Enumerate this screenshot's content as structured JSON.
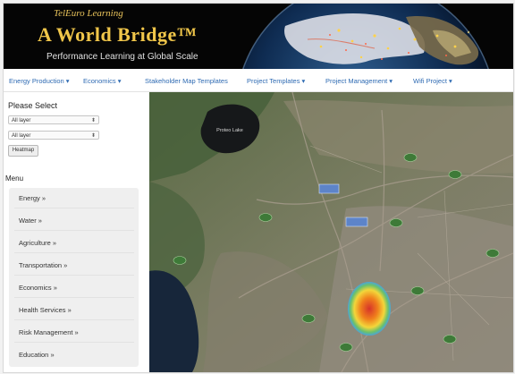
{
  "header": {
    "brand_small": "TelEuro Learning",
    "brand_big": "A World Bridge™",
    "tagline": "Performance Learning at Global Scale"
  },
  "nav": {
    "items": [
      {
        "label": "Energy Production ▾"
      },
      {
        "label": "Economics ▾"
      },
      {
        "label": "Stakeholder Map Templates"
      },
      {
        "label": "Project Templates ▾"
      },
      {
        "label": "Project Management ▾"
      },
      {
        "label": "Wifi Project ▾"
      }
    ]
  },
  "sidebar": {
    "please_select": "Please Select",
    "select1": "All layer",
    "select2": "All layer",
    "heatmap_button": "Heatmap",
    "menu_title": "Menu",
    "menu_items": [
      {
        "label": "Energy »"
      },
      {
        "label": "Water »"
      },
      {
        "label": "Agriculture »"
      },
      {
        "label": "Transportation »"
      },
      {
        "label": "Economics »"
      },
      {
        "label": "Health Services »"
      },
      {
        "label": "Risk Management »"
      },
      {
        "label": "Education »"
      }
    ]
  },
  "map": {
    "lake_label": "Proteo Lake",
    "heatmap_colors": [
      "#d6332a",
      "#f07f1c",
      "#f3d63a",
      "#4aa5d9"
    ]
  }
}
